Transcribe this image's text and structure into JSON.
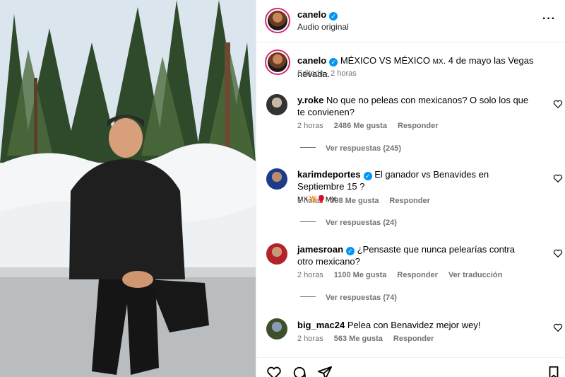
{
  "header": {
    "username": "canelo",
    "subtitle": "Audio original",
    "more_icon": "more-horizontal-icon"
  },
  "caption": {
    "username": "canelo",
    "text_main": "MÉXICO VS MÉXICO",
    "text_mx": "MX",
    "text_rest": ". 4 de mayo las Vegas nevada.",
    "meta": "Editado · 2 horas"
  },
  "comments": [
    {
      "username": "y.roke",
      "verified": false,
      "text": "No que no peleas con mexicanos? O solo los que te convienen?",
      "time": "2 horas",
      "likes": "2486 Me gusta",
      "reply": "Responder",
      "view_replies": "Ver respuestas (245)"
    },
    {
      "username": "karimdeportes",
      "verified": true,
      "text": "El ganador vs Benavides en Septiembre 15 ?",
      "text_line2": "MX💥🥊MX",
      "time": "1 hora",
      "likes": "598 Me gusta",
      "reply": "Responder",
      "view_replies": "Ver respuestas (24)"
    },
    {
      "username": "jamesroan",
      "verified": true,
      "text": "¿Pensaste que nunca pelearías contra otro mexicano?",
      "time": "2 horas",
      "likes": "1100 Me gusta",
      "reply": "Responder",
      "translate": "Ver traducción",
      "view_replies": "Ver respuestas (74)"
    },
    {
      "username": "big_mac24",
      "verified": false,
      "text": "Pelea con Benavidez mejor wey!",
      "time": "2 horas",
      "likes": "563 Me gusta",
      "reply": "Responder"
    }
  ],
  "actions": {
    "like_icon": "heart-icon",
    "comment_icon": "comment-icon",
    "share_icon": "send-icon",
    "save_icon": "bookmark-icon"
  },
  "colors": {
    "accent": "#0095f6",
    "story_ring": "#d62976",
    "muted_text": "#737373"
  }
}
